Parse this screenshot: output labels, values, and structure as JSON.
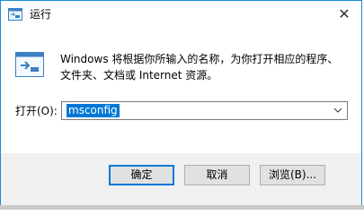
{
  "window": {
    "title": "运行",
    "close_glyph": "✕"
  },
  "description": {
    "line1": "Windows 将根据你所输入的名称，为你打开相应的程序、",
    "line2": "文件夹、文档或 Internet 资源。"
  },
  "open_field": {
    "label": "打开(O):",
    "value": "msconfig"
  },
  "buttons": {
    "ok": "确定",
    "cancel": "取消",
    "browse": "浏览(B)..."
  },
  "colors": {
    "accent": "#0078d7",
    "window_border": "#1b8bd6",
    "footer_bg": "#f0f0f0"
  },
  "icons": {
    "app": "run-app-icon",
    "run": "run-window-icon",
    "dropdown": "chevron-down-icon",
    "close": "close-icon"
  }
}
